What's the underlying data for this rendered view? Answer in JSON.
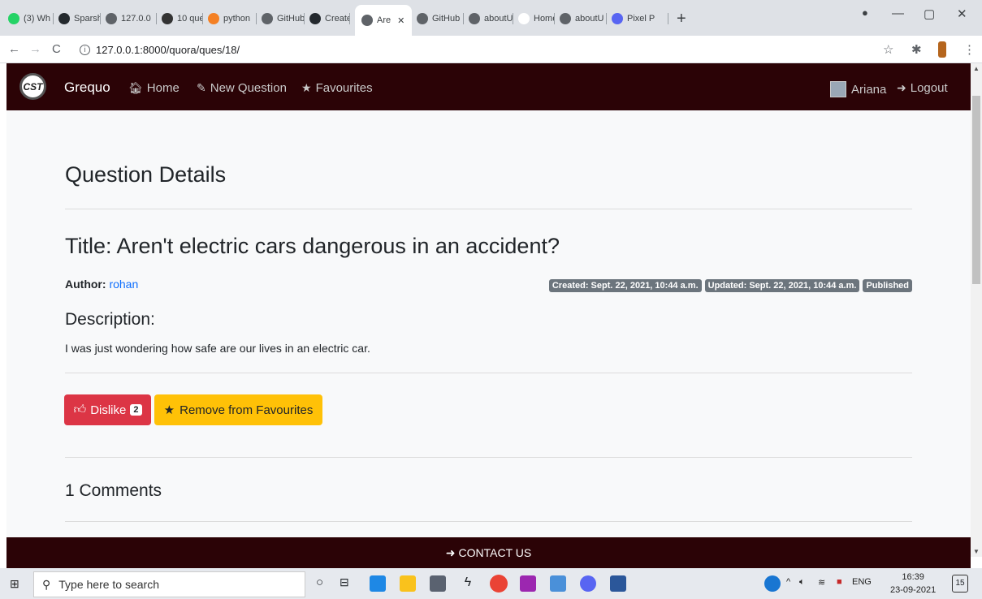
{
  "browser": {
    "tabs": [
      {
        "label": "(3) Wh",
        "icon": "whatsapp-icon",
        "color": "#25d366"
      },
      {
        "label": "Sparsh",
        "icon": "github-icon",
        "color": "#24292e"
      },
      {
        "label": "127.0.0",
        "icon": "globe-icon",
        "color": "#5f6368"
      },
      {
        "label": "10 que",
        "icon": "quiz-icon",
        "color": "#333333"
      },
      {
        "label": "python",
        "icon": "stackoverflow-icon",
        "color": "#f48024"
      },
      {
        "label": "GitHub",
        "icon": "globe-icon",
        "color": "#5f6368"
      },
      {
        "label": "Create",
        "icon": "github-icon",
        "color": "#24292e"
      },
      {
        "label": "Are",
        "icon": "globe-icon",
        "color": "#5f6368",
        "active": true
      },
      {
        "label": "GitHub",
        "icon": "globe-icon",
        "color": "#5f6368"
      },
      {
        "label": "aboutU",
        "icon": "globe-icon",
        "color": "#5f6368"
      },
      {
        "label": "Home",
        "icon": "blank-icon",
        "color": "#ffffff"
      },
      {
        "label": "aboutU",
        "icon": "globe-icon",
        "color": "#5f6368"
      },
      {
        "label": "Pixel P",
        "icon": "discord-icon",
        "color": "#5865f2"
      }
    ],
    "new_tab": "+",
    "url": "127.0.0.1:8000/quora/ques/18/"
  },
  "navbar": {
    "logo": "CST",
    "brand": "Grequo",
    "links": [
      {
        "label": "Home",
        "icon": "home-icon"
      },
      {
        "label": "New Question",
        "icon": "edit-icon"
      },
      {
        "label": "Favourites",
        "icon": "star-icon"
      }
    ],
    "user": "Ariana",
    "logout": "Logout"
  },
  "page": {
    "heading": "Question Details",
    "title": "Title: Aren't electric cars dangerous in an accident?",
    "author_label": "Author:",
    "author_name": "rohan",
    "badges": [
      "Created: Sept. 22, 2021, 10:44 a.m.",
      "Updated: Sept. 22, 2021, 10:44 a.m.",
      "Published"
    ],
    "description_heading": "Description:",
    "description": "I was just wondering how safe are our lives in an electric car.",
    "dislike_label": "Dislike",
    "dislike_count": "2",
    "favourite_label": "Remove from Favourites",
    "comments_heading": "1 Comments"
  },
  "footer": {
    "label": "CONTACT US"
  },
  "taskbar": {
    "search_placeholder": "Type here to search",
    "language": "ENG",
    "time": "16:39",
    "date": "23-09-2021",
    "notifications": "15"
  },
  "colors": {
    "navbar": "#2b0306",
    "danger": "#dc3545",
    "warning": "#ffc107",
    "badge": "#6c757d",
    "link": "#0d6efd"
  }
}
